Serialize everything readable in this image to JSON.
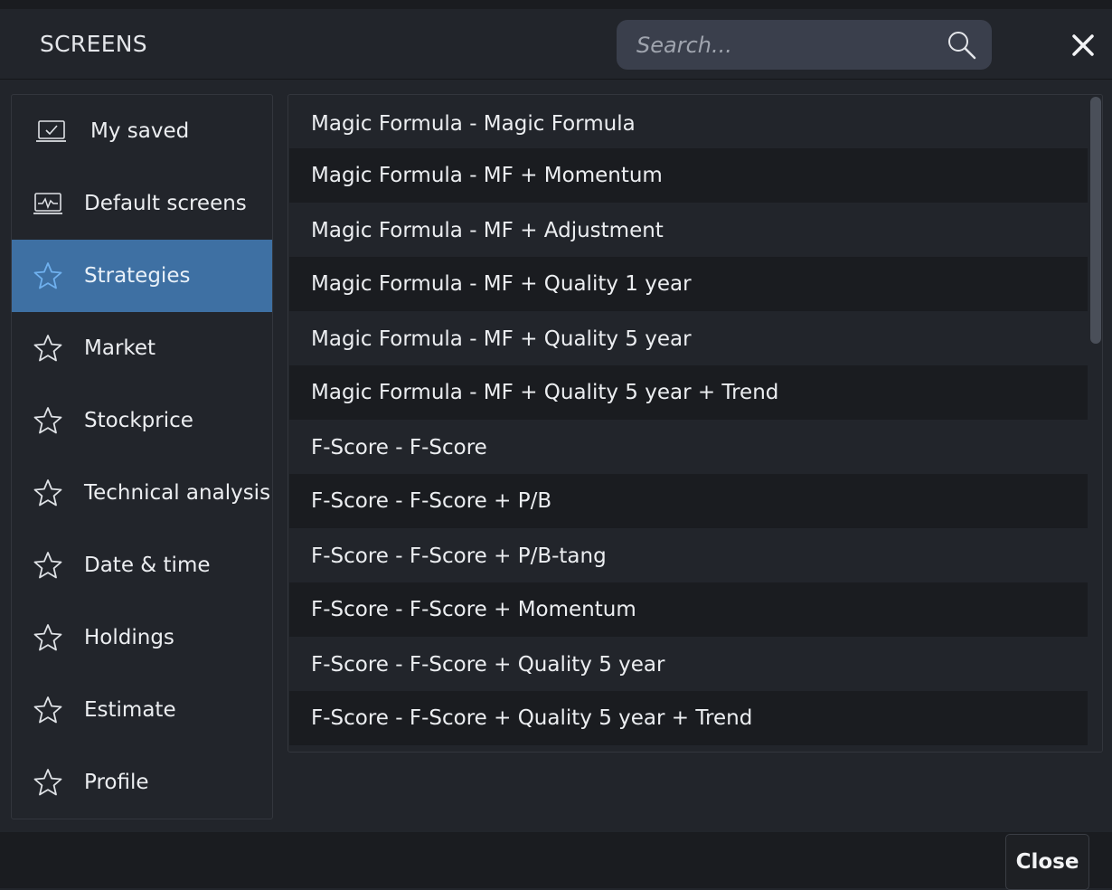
{
  "header": {
    "title": "SCREENS",
    "search_placeholder": "Search..."
  },
  "sidebar": {
    "items": [
      {
        "label": "My saved",
        "icon": "laptop-check-icon",
        "active": false
      },
      {
        "label": "Default screens",
        "icon": "chart-monitor-icon",
        "active": false
      },
      {
        "label": "Strategies",
        "icon": "star-icon",
        "active": true
      },
      {
        "label": "Market",
        "icon": "star-icon",
        "active": false
      },
      {
        "label": "Stockprice",
        "icon": "star-icon",
        "active": false
      },
      {
        "label": "Technical analysis",
        "icon": "star-icon",
        "active": false
      },
      {
        "label": "Date & time",
        "icon": "star-icon",
        "active": false
      },
      {
        "label": "Holdings",
        "icon": "star-icon",
        "active": false
      },
      {
        "label": "Estimate",
        "icon": "star-icon",
        "active": false
      },
      {
        "label": "Profile",
        "icon": "star-icon",
        "active": false
      }
    ]
  },
  "list": {
    "items": [
      "Magic Formula - Magic Formula",
      "Magic Formula - MF + Momentum",
      "Magic Formula - MF + Adjustment",
      "Magic Formula - MF + Quality 1 year",
      "Magic Formula - MF + Quality 5 year",
      "Magic Formula - MF + Quality 5 year + Trend",
      "F-Score - F-Score",
      "F-Score - F-Score + P/B",
      "F-Score - F-Score + P/B-tang",
      "F-Score - F-Score + Momentum",
      "F-Score - F-Score + Quality 5 year",
      "F-Score - F-Score + Quality 5 year + Trend"
    ]
  },
  "footer": {
    "close_label": "Close"
  },
  "colors": {
    "background": "#22252b",
    "alt_row": "#1a1c20",
    "active_item": "#3e70a3",
    "search_bg": "#3a3f4c"
  }
}
